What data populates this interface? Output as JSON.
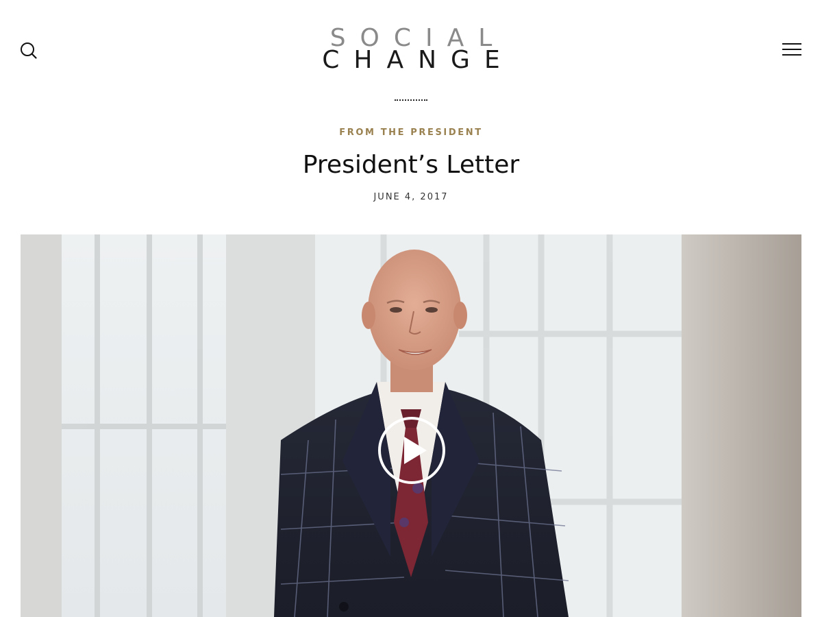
{
  "header": {
    "logo": {
      "line1": "SOCIAL",
      "line2": "CHANGE"
    },
    "icons": {
      "search": "search-icon",
      "menu": "hamburger-menu-icon"
    }
  },
  "article": {
    "kicker": "FROM THE PRESIDENT",
    "title": "President’s Letter",
    "date": "JUNE 4, 2017"
  },
  "video": {
    "play_icon": "play-icon"
  },
  "colors": {
    "kicker": "#9a8150",
    "text": "#111111",
    "logo_top": "#8a8a8a",
    "logo_bottom": "#1a1a1a"
  }
}
